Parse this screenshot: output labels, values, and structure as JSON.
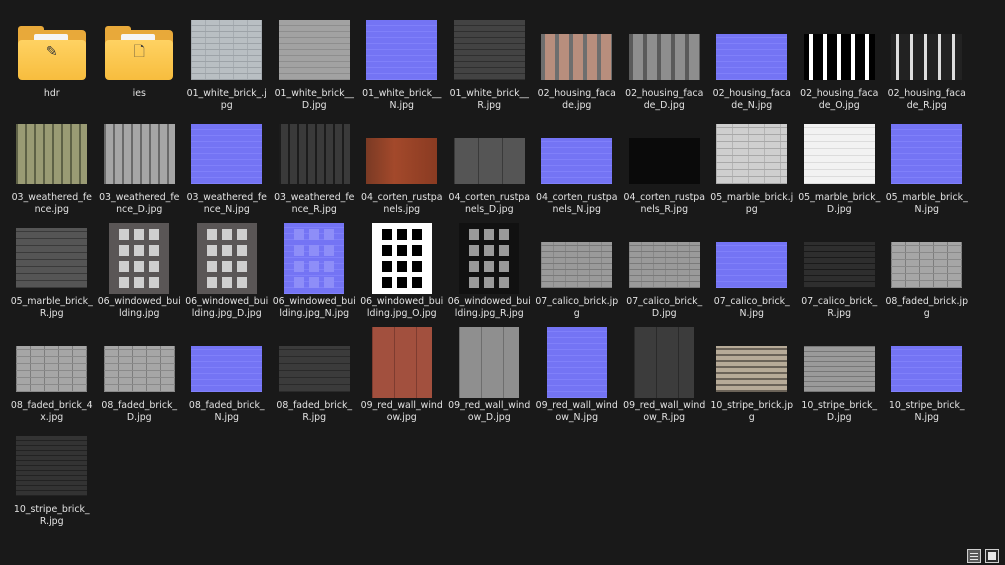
{
  "items": [
    {
      "label": "hdr",
      "kind": "folder",
      "glyph": "✎"
    },
    {
      "label": "ies",
      "kind": "folder",
      "glyph": "🗋"
    },
    {
      "label": "01_white_brick_.jpg",
      "tex": "t-white"
    },
    {
      "label": "01_white_brick__D.jpg",
      "tex": "t-whiteD"
    },
    {
      "label": "01_white_brick__N.jpg",
      "tex": "t-normal"
    },
    {
      "label": "01_white_brick__R.jpg",
      "tex": "t-darkR"
    },
    {
      "label": "02_housing_facade.jpg",
      "tex": "t-facade",
      "shape": "wide"
    },
    {
      "label": "02_housing_facade_D.jpg",
      "tex": "t-facadeD",
      "shape": "wide"
    },
    {
      "label": "02_housing_facade_N.jpg",
      "tex": "t-normal",
      "shape": "wide"
    },
    {
      "label": "02_housing_facade_O.jpg",
      "tex": "t-facadeO",
      "shape": "wide"
    },
    {
      "label": "02_housing_facade_R.jpg",
      "tex": "t-facadeR",
      "shape": "wide"
    },
    {
      "label": "03_weathered_fence.jpg",
      "tex": "t-fence"
    },
    {
      "label": "03_weathered_fence_D.jpg",
      "tex": "t-fenceD"
    },
    {
      "label": "03_weathered_fence_N.jpg",
      "tex": "t-normal"
    },
    {
      "label": "03_weathered_fence_R.jpg",
      "tex": "t-fenceR"
    },
    {
      "label": "04_corten_rustpanels.jpg",
      "tex": "t-corten",
      "shape": "wide"
    },
    {
      "label": "04_corten_rustpanels_D.jpg",
      "tex": "t-cortenD",
      "shape": "wide"
    },
    {
      "label": "04_corten_rustpanels_N.jpg",
      "tex": "t-normal",
      "shape": "wide"
    },
    {
      "label": "04_corten_rustpanels_R.jpg",
      "tex": "t-black",
      "shape": "wide"
    },
    {
      "label": "05_marble_brick.jpg",
      "tex": "t-marble"
    },
    {
      "label": "05_marble_brick_D.jpg",
      "tex": "t-marbleD"
    },
    {
      "label": "05_marble_brick_N.jpg",
      "tex": "t-normal"
    },
    {
      "label": "05_marble_brick_R.jpg",
      "tex": "t-marbleR"
    },
    {
      "label": "06_windowed_building.jpg",
      "tex": "t-windowed",
      "shape": "tall",
      "win": "win-base"
    },
    {
      "label": "06_windowed_building.jpg_D.jpg",
      "tex": "t-windowed",
      "shape": "tall",
      "win": "win-D"
    },
    {
      "label": "06_windowed_building.jpg_N.jpg",
      "tex": "t-normal",
      "shape": "tall",
      "win": "win-N"
    },
    {
      "label": "06_windowed_building.jpg_O.jpg",
      "tex": "t-windowed",
      "shape": "tall",
      "win": "win-O"
    },
    {
      "label": "06_windowed_building.jpg_R.jpg",
      "tex": "t-windowed",
      "shape": "tall",
      "win": "win-R"
    },
    {
      "label": "07_calico_brick.jpg",
      "tex": "t-calico",
      "shape": "wide"
    },
    {
      "label": "07_calico_brick_D.jpg",
      "tex": "t-calico",
      "shape": "wide"
    },
    {
      "label": "07_calico_brick_N.jpg",
      "tex": "t-normal",
      "shape": "wide"
    },
    {
      "label": "07_calico_brick_R.jpg",
      "tex": "t-calicoR",
      "shape": "wide"
    },
    {
      "label": "08_faded_brick.jpg",
      "tex": "t-faded",
      "shape": "wide"
    },
    {
      "label": "08_faded_brick_4x.jpg",
      "tex": "t-faded",
      "shape": "wide"
    },
    {
      "label": "08_faded_brick_D.jpg",
      "tex": "t-faded",
      "shape": "wide"
    },
    {
      "label": "08_faded_brick_N.jpg",
      "tex": "t-normal",
      "shape": "wide"
    },
    {
      "label": "08_faded_brick_R.jpg",
      "tex": "t-fadedR",
      "shape": "wide"
    },
    {
      "label": "09_red_wall_window.jpg",
      "tex": "t-redwall",
      "shape": "tall"
    },
    {
      "label": "09_red_wall_window_D.jpg",
      "tex": "t-redwallD",
      "shape": "tall"
    },
    {
      "label": "09_red_wall_window_N.jpg",
      "tex": "t-normal",
      "shape": "tall"
    },
    {
      "label": "09_red_wall_window_R.jpg",
      "tex": "t-redwallR",
      "shape": "tall"
    },
    {
      "label": "10_stripe_brick.jpg",
      "tex": "t-stripe",
      "shape": "wide"
    },
    {
      "label": "10_stripe_brick_D.jpg",
      "tex": "t-stripeD",
      "shape": "wide"
    },
    {
      "label": "10_stripe_brick_N.jpg",
      "tex": "t-normal",
      "shape": "wide"
    },
    {
      "label": "10_stripe_brick_R.jpg",
      "tex": "t-stripeR"
    }
  ],
  "view_buttons": [
    {
      "name": "details-view-button",
      "icon": "list-view-icon",
      "active": true
    },
    {
      "name": "thumbnail-view-button",
      "icon": "large-icons-view-icon",
      "active": false
    }
  ],
  "colors": {
    "background": "#191919",
    "folder": "#f7bd3e",
    "normal_map": "#7474f4"
  }
}
